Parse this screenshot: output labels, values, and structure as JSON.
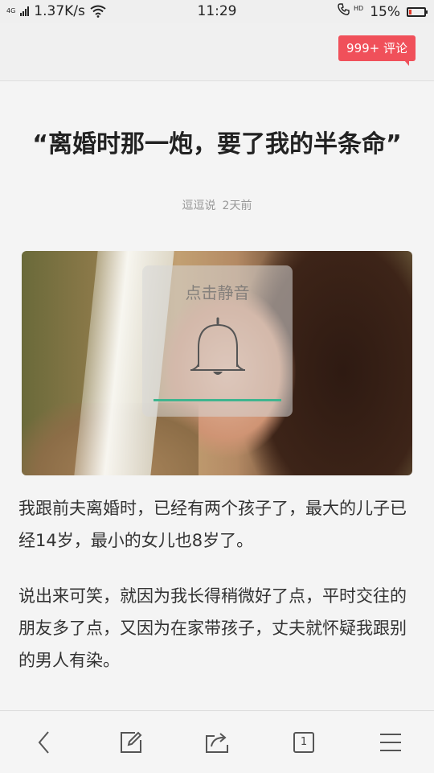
{
  "status_bar": {
    "network_type": "4G",
    "speed": "1.37K/s",
    "time": "11:29",
    "hd_label": "HD",
    "battery": "15%",
    "battery_level": 0.15
  },
  "header": {
    "comment_badge": "999+ 评论"
  },
  "article": {
    "title": "“离婚时那一炮，要了我的半条命”",
    "author": "逗逗说",
    "posted": "2天前",
    "paragraphs": [
      "我跟前夫离婚时，已经有两个孩子了，最大的儿子已经14岁，最小的女儿也8岁了。",
      "说出来可笑，就因为我长得稍微好了点，平时交往的朋友多了点，又因为在家带孩子，丈夫就怀疑我跟别的男人有染。"
    ]
  },
  "video": {
    "mute_label": "点击静音",
    "volume_level": 1.0,
    "icon": "bell-icon"
  },
  "bottom_bar": {
    "tab_count": "1",
    "icons": [
      "back-icon",
      "edit-icon",
      "share-icon",
      "tabs-icon",
      "menu-icon"
    ]
  }
}
